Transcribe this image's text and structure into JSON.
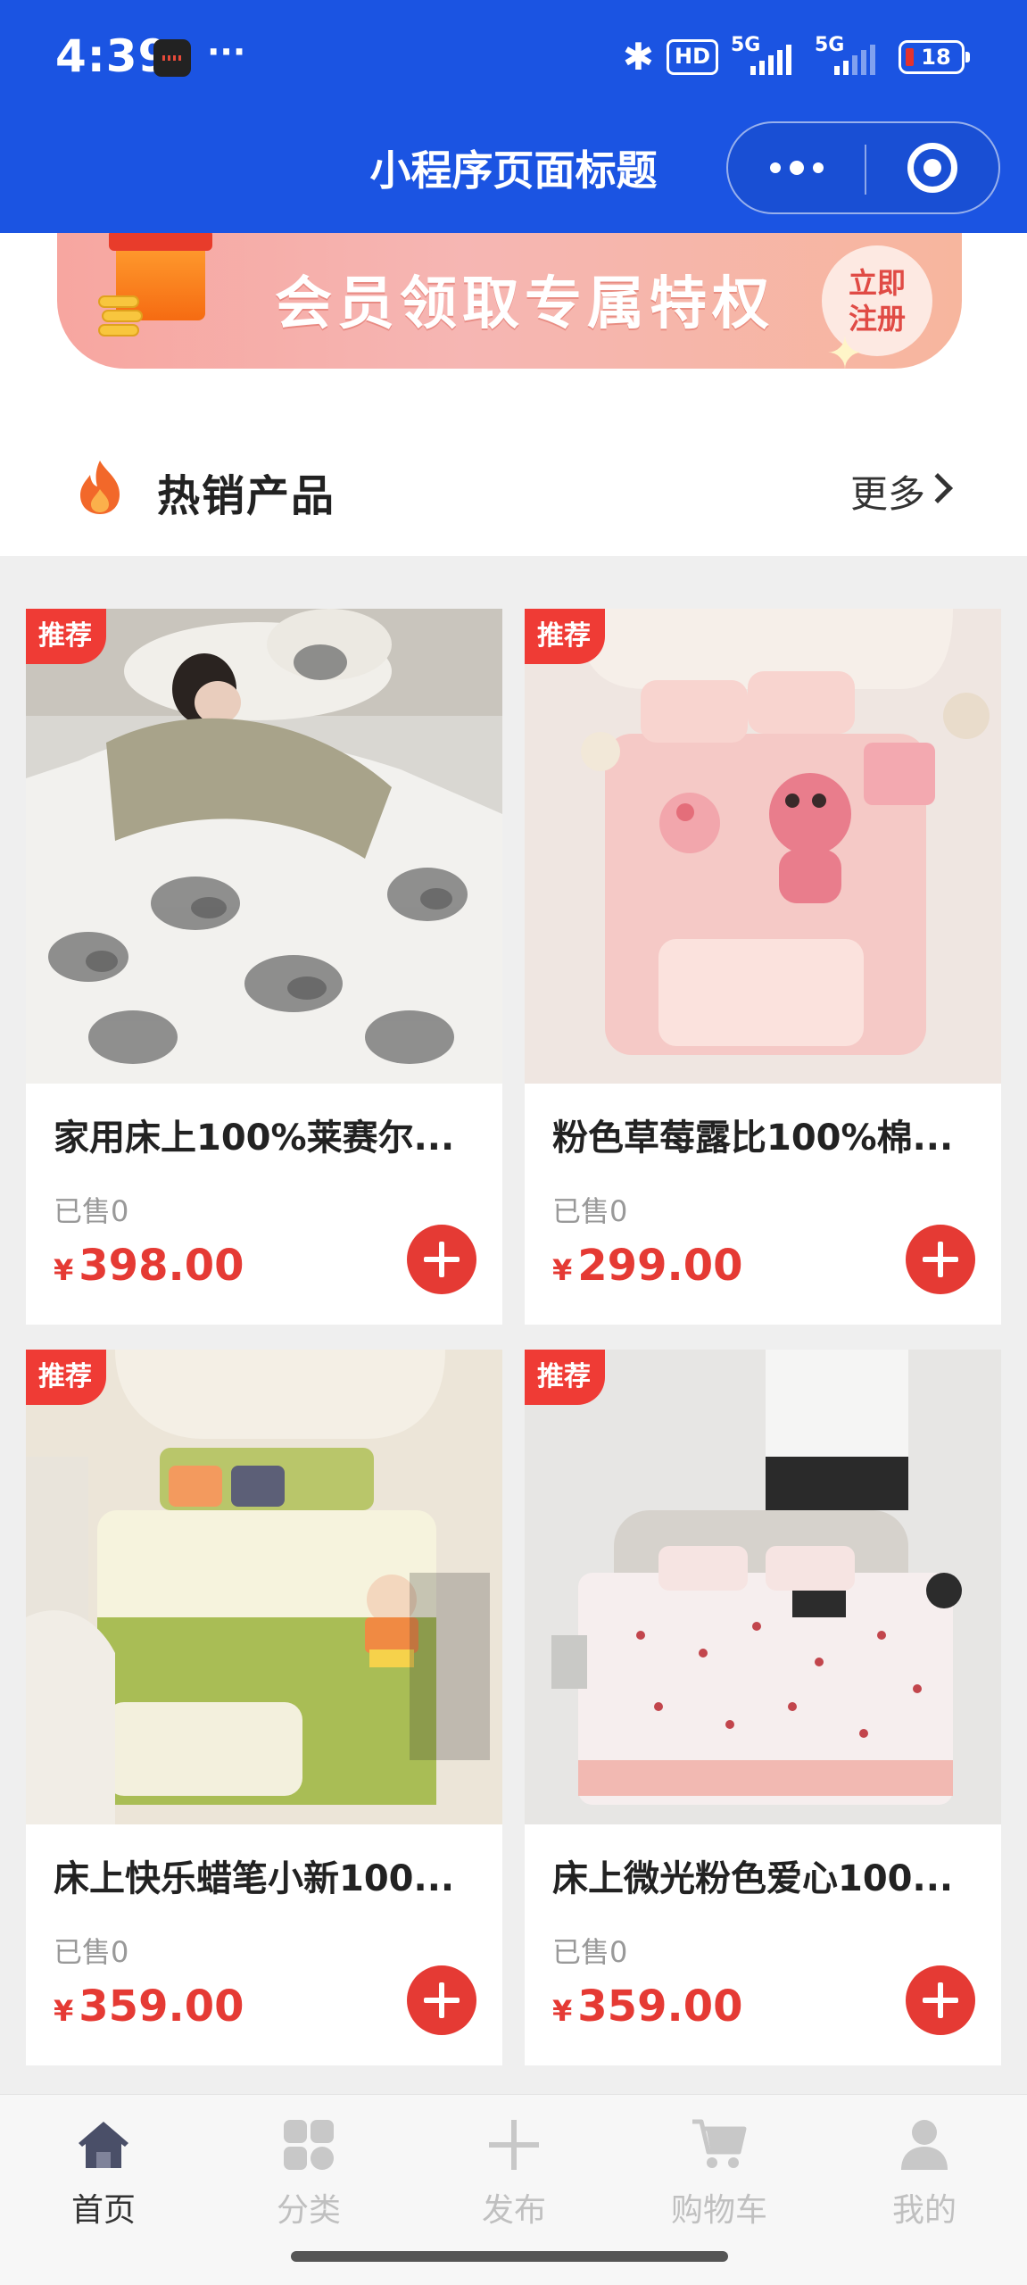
{
  "status_bar": {
    "time": "4:39",
    "dots": "···",
    "hd_label": "HD",
    "network_1": "5G",
    "network_2": "5G",
    "battery": "18"
  },
  "nav": {
    "title": "小程序页面标题"
  },
  "banner": {
    "text": "会员领取专属特权",
    "button_label": "立即注册"
  },
  "hot_section": {
    "title": "热销产品",
    "more_label": "更多"
  },
  "products": [
    {
      "tag": "推荐",
      "title": "家用床上100%莱赛尔...",
      "sold": "已售0",
      "currency": "¥",
      "price": "398.00"
    },
    {
      "tag": "推荐",
      "title": "粉色草莓露比100%棉...",
      "sold": "已售0",
      "currency": "¥",
      "price": "299.00"
    },
    {
      "tag": "推荐",
      "title": "床上快乐蜡笔小新100...",
      "sold": "已售0",
      "currency": "¥",
      "price": "359.00"
    },
    {
      "tag": "推荐",
      "title": "床上微光粉色爱心100...",
      "sold": "已售0",
      "currency": "¥",
      "price": "359.00"
    }
  ],
  "tabbar": {
    "items": [
      {
        "label": "首页",
        "icon": "home-icon",
        "active": true
      },
      {
        "label": "分类",
        "icon": "category-grid-icon",
        "active": false
      },
      {
        "label": "发布",
        "icon": "plus-icon",
        "active": false
      },
      {
        "label": "购物车",
        "icon": "cart-icon",
        "active": false
      },
      {
        "label": "我的",
        "icon": "profile-icon",
        "active": false
      }
    ]
  },
  "colors": {
    "header_blue": "#1b54e2",
    "accent_red": "#e53a34",
    "tab_inactive": "#c0c0c0",
    "tab_active": "#333333"
  }
}
